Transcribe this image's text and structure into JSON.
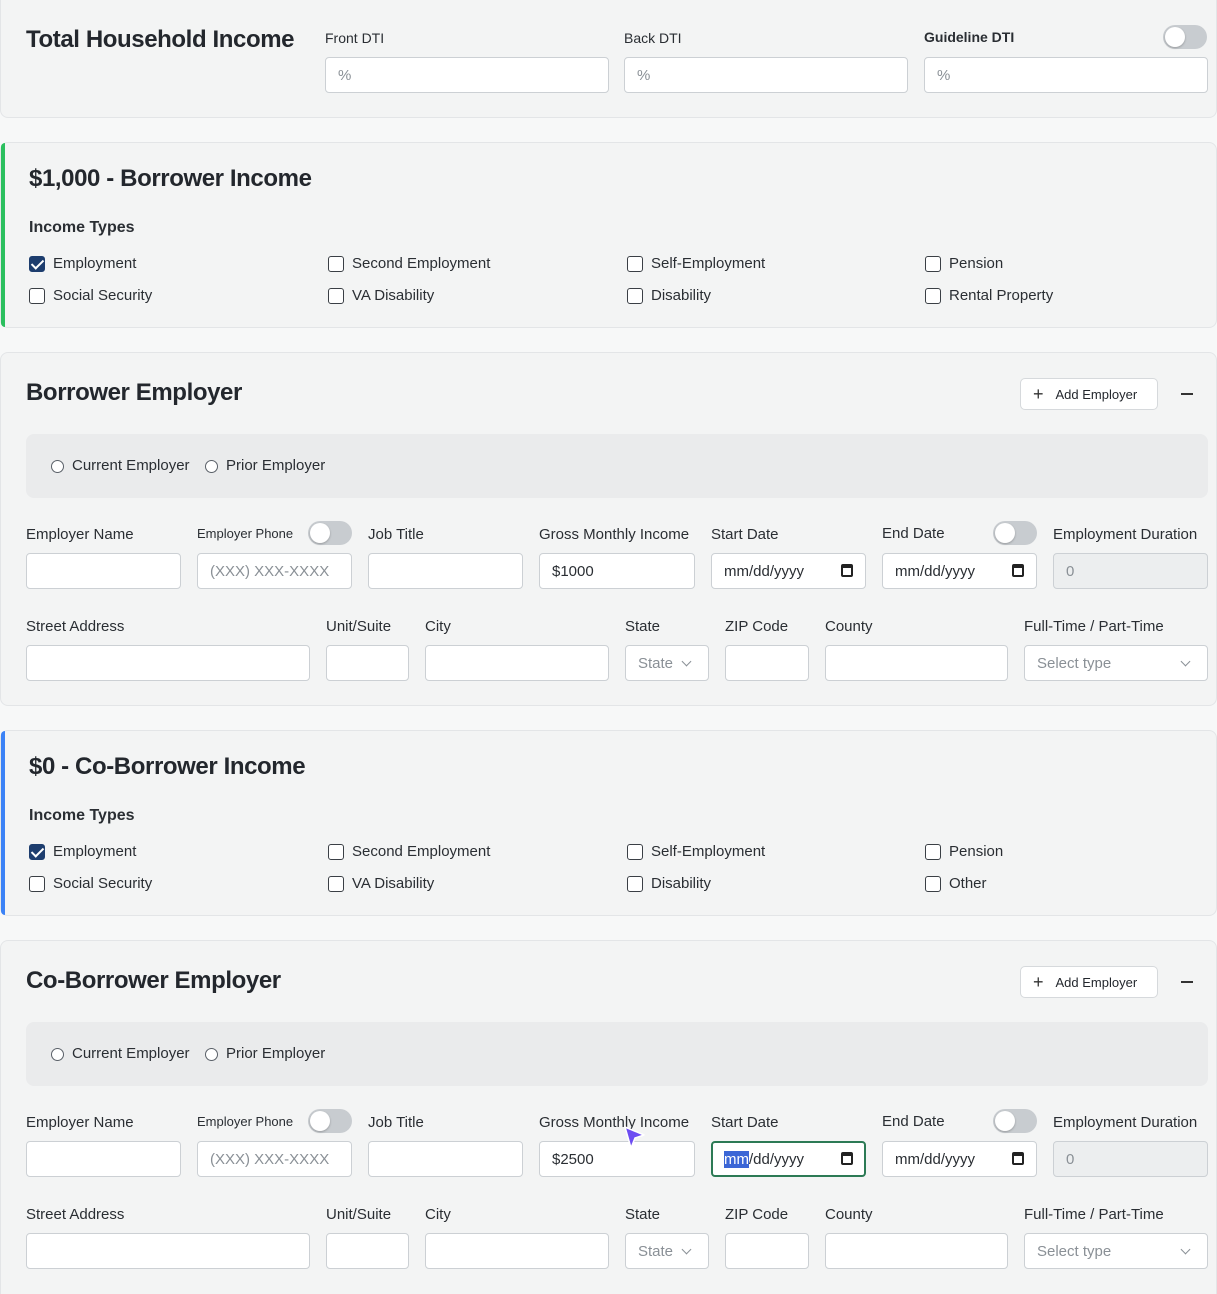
{
  "dti": {
    "title": "Total Household Income",
    "front_label": "Front DTI",
    "front_placeholder": "%",
    "back_label": "Back DTI",
    "back_placeholder": "%",
    "guideline_label": "Guideline DTI",
    "guideline_placeholder": "%",
    "guideline_toggle": "off"
  },
  "borrower_income": {
    "title": "$1,000 - Borrower Income",
    "types_heading": "Income Types",
    "accent_color": "#2bbf5e",
    "types": [
      {
        "label": "Employment",
        "checked": true
      },
      {
        "label": "Second Employment",
        "checked": false
      },
      {
        "label": "Self-Employment",
        "checked": false
      },
      {
        "label": "Pension",
        "checked": false
      },
      {
        "label": "Social Security",
        "checked": false
      },
      {
        "label": "VA Disability",
        "checked": false
      },
      {
        "label": "Disability",
        "checked": false
      },
      {
        "label": "Rental Property",
        "checked": false
      }
    ]
  },
  "borrower_employer": {
    "title": "Borrower Employer",
    "add_label": "Add Employer",
    "radio_current": "Current Employer",
    "radio_prior": "Prior Employer",
    "employer_name_label": "Employer Name",
    "employer_phone_label": "Employer Phone",
    "employer_phone_placeholder": "(XXX) XXX-XXXX",
    "job_title_label": "Job Title",
    "gross_label": "Gross Monthly Income",
    "gross_value": "$1000",
    "start_label": "Start Date",
    "start_placeholder": "mm/dd/yyyy",
    "end_label": "End Date",
    "end_placeholder": "mm/dd/yyyy",
    "duration_label": "Employment Duration",
    "duration_value": "0",
    "street_label": "Street Address",
    "unit_label": "Unit/Suite",
    "city_label": "City",
    "state_label": "State",
    "state_placeholder": "State",
    "zip_label": "ZIP Code",
    "county_label": "County",
    "fulltime_label": "Full-Time / Part-Time",
    "fulltime_placeholder": "Select type"
  },
  "coborrower_income": {
    "title": "$0 - Co-Borrower Income",
    "types_heading": "Income Types",
    "accent_color": "#3b82f6",
    "types": [
      {
        "label": "Employment",
        "checked": true
      },
      {
        "label": "Second Employment",
        "checked": false
      },
      {
        "label": "Self-Employment",
        "checked": false
      },
      {
        "label": "Pension",
        "checked": false
      },
      {
        "label": "Social Security",
        "checked": false
      },
      {
        "label": "VA Disability",
        "checked": false
      },
      {
        "label": "Disability",
        "checked": false
      },
      {
        "label": "Other",
        "checked": false
      }
    ]
  },
  "coborrower_employer": {
    "title": "Co-Borrower Employer",
    "add_label": "Add Employer",
    "radio_current": "Current Employer",
    "radio_prior": "Prior Employer",
    "employer_name_label": "Employer Name",
    "employer_phone_label": "Employer Phone",
    "employer_phone_placeholder": "(XXX) XXX-XXXX",
    "job_title_label": "Job Title",
    "gross_label": "Gross Monthly Income",
    "gross_value": "$2500",
    "start_label": "Start Date",
    "start_placeholder_selected": "mm",
    "start_placeholder_rest": "/dd/yyyy",
    "end_label": "End Date",
    "end_placeholder": "mm/dd/yyyy",
    "duration_label": "Employment Duration",
    "duration_value": "0",
    "street_label": "Street Address",
    "unit_label": "Unit/Suite",
    "city_label": "City",
    "state_label": "State",
    "state_placeholder": "State",
    "zip_label": "ZIP Code",
    "county_label": "County",
    "fulltime_label": "Full-Time / Part-Time",
    "fulltime_placeholder": "Select type"
  },
  "cursor_color": "#6d4df2"
}
